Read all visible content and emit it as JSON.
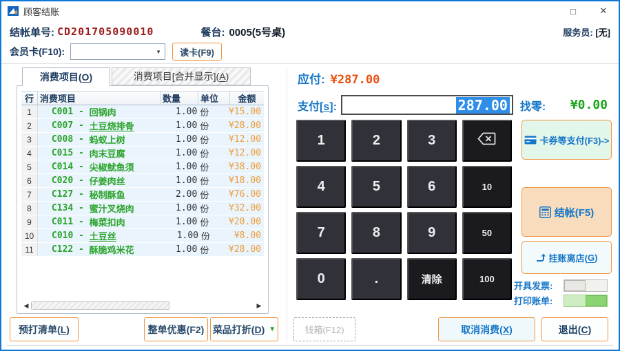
{
  "window": {
    "title": "顾客结账",
    "controls": {
      "maximize": "□",
      "close": "✕"
    }
  },
  "header": {
    "bill_no_label": "结帐单号:",
    "bill_no": "CD201705090010",
    "table_label": "餐台:",
    "table_value": "0005(5号桌)",
    "waiter_label": "服务员:",
    "waiter_value": "[无]",
    "member_card_label": "会员卡(F10):",
    "member_card_value": "",
    "read_card_button": "读卡(F9)"
  },
  "tabs": {
    "tab1": {
      "pre": "消费项目(",
      "key": "O",
      "post": ")"
    },
    "tab2": {
      "pre": "消费项目[合并显示](",
      "key": "A",
      "post": ")"
    }
  },
  "table": {
    "col_row": "行",
    "col_item": "消费项目",
    "col_qty": "数量",
    "col_unit": "单位",
    "col_amount": "金额",
    "rows": [
      {
        "row": "1",
        "code_label": "C001 - ",
        "name": "回锅肉",
        "underline": false,
        "qty": "1.00",
        "unit": "份",
        "amount": "¥15.00"
      },
      {
        "row": "2",
        "code_label": "C007 - ",
        "name": "土豆烧排骨",
        "underline": true,
        "qty": "1.00",
        "unit": "份",
        "amount": "¥28.00"
      },
      {
        "row": "3",
        "code_label": "C008 - ",
        "name": "蚂蚁上树",
        "underline": false,
        "qty": "1.00",
        "unit": "份",
        "amount": "¥12.00"
      },
      {
        "row": "4",
        "code_label": "C015 - ",
        "name": "肉末豆腐",
        "underline": false,
        "qty": "1.00",
        "unit": "份",
        "amount": "¥12.00"
      },
      {
        "row": "5",
        "code_label": "C014 - ",
        "name": "尖椒鱿鱼须",
        "underline": false,
        "qty": "1.00",
        "unit": "份",
        "amount": "¥38.00"
      },
      {
        "row": "6",
        "code_label": "C020 - ",
        "name": "仔姜肉丝",
        "underline": false,
        "qty": "1.00",
        "unit": "份",
        "amount": "¥18.00"
      },
      {
        "row": "7",
        "code_label": "C127 - ",
        "name": "秘制酥鱼",
        "underline": false,
        "qty": "2.00",
        "unit": "份",
        "amount": "¥76.00"
      },
      {
        "row": "8",
        "code_label": "C134 - ",
        "name": "蜜汁叉烧肉",
        "underline": false,
        "qty": "1.00",
        "unit": "份",
        "amount": "¥32.00"
      },
      {
        "row": "9",
        "code_label": "C011 - ",
        "name": "梅菜扣肉",
        "underline": false,
        "qty": "1.00",
        "unit": "份",
        "amount": "¥20.00"
      },
      {
        "row": "10",
        "code_label": "C010 - ",
        "name": "土豆丝",
        "underline": true,
        "qty": "1.00",
        "unit": "份",
        "amount": "¥8.00"
      },
      {
        "row": "11",
        "code_label": "C122 - ",
        "name": "酥脆鸡米花",
        "underline": false,
        "qty": "1.00",
        "unit": "份",
        "amount": "¥28.00"
      }
    ]
  },
  "left_actions": {
    "preprint": {
      "pre": "预打清单(",
      "key": "L",
      "post": ")"
    },
    "discount_all": "整单优惠(F2)",
    "dish_discount": {
      "pre": "菜品打折(",
      "key": "D",
      "post": ")"
    },
    "dish_discount_arrow": "▼"
  },
  "payment": {
    "due_label": "应付:",
    "due_amount": "¥287.00",
    "pay_label_pre": "支付[",
    "pay_key": "s",
    "pay_label_post": "]:",
    "pay_value": "287.00",
    "change_label": "找零:",
    "change_amount": "¥0.00"
  },
  "numpad": {
    "keys": [
      {
        "label": "1",
        "name": "key-1"
      },
      {
        "label": "2",
        "name": "key-2"
      },
      {
        "label": "3",
        "name": "key-3"
      },
      {
        "label": "",
        "name": "backspace-key",
        "icon": "backspace",
        "variant": "dark"
      },
      {
        "label": "4",
        "name": "key-4"
      },
      {
        "label": "5",
        "name": "key-5"
      },
      {
        "label": "6",
        "name": "key-6"
      },
      {
        "label": "10",
        "name": "key-10",
        "variant": "dark small"
      },
      {
        "label": "7",
        "name": "key-7"
      },
      {
        "label": "8",
        "name": "key-8"
      },
      {
        "label": "9",
        "name": "key-9"
      },
      {
        "label": "50",
        "name": "key-50",
        "variant": "dark small"
      },
      {
        "label": "0",
        "name": "key-0"
      },
      {
        "label": ".",
        "name": "key-dot"
      },
      {
        "label": "清除",
        "name": "clear-key",
        "variant": "dark mid"
      },
      {
        "label": "100",
        "name": "key-100",
        "variant": "dark small"
      }
    ]
  },
  "right_panel": {
    "card_pay": "卡券等支付(F3)->",
    "settle": "结帐(F5)",
    "credit": {
      "pre": "挂账离店(",
      "key": "G",
      "post": ")"
    },
    "invoice_label": "开具发票:",
    "invoice_state": "off",
    "print_label": "打印账单:",
    "print_state": "on"
  },
  "bottom_actions": {
    "cash_drawer": "钱箱(F12)",
    "cancel": {
      "pre": "取消消费(",
      "key": "X",
      "post": ")"
    },
    "exit": {
      "pre": "退出(",
      "key": "C",
      "post": ")"
    }
  },
  "scrollbar": {
    "left_arrow": "◀",
    "right_arrow": "▶"
  },
  "colors": {
    "window_border": "#1079d8",
    "accent_blue": "#1576c8",
    "navy": "#1c3a5e",
    "bill_red": "#9b1c1c",
    "due_orange": "#e8500f",
    "amount_orange": "#ef9d3a",
    "item_green": "#2ba42b",
    "change_green": "#1ea31e",
    "orange_border": "#ef9440",
    "numpad_dark": "#31313a",
    "numpad_darker": "#1a1a1f",
    "row_bg": "#e9f4fd",
    "selection_blue": "#2f8fe8"
  }
}
